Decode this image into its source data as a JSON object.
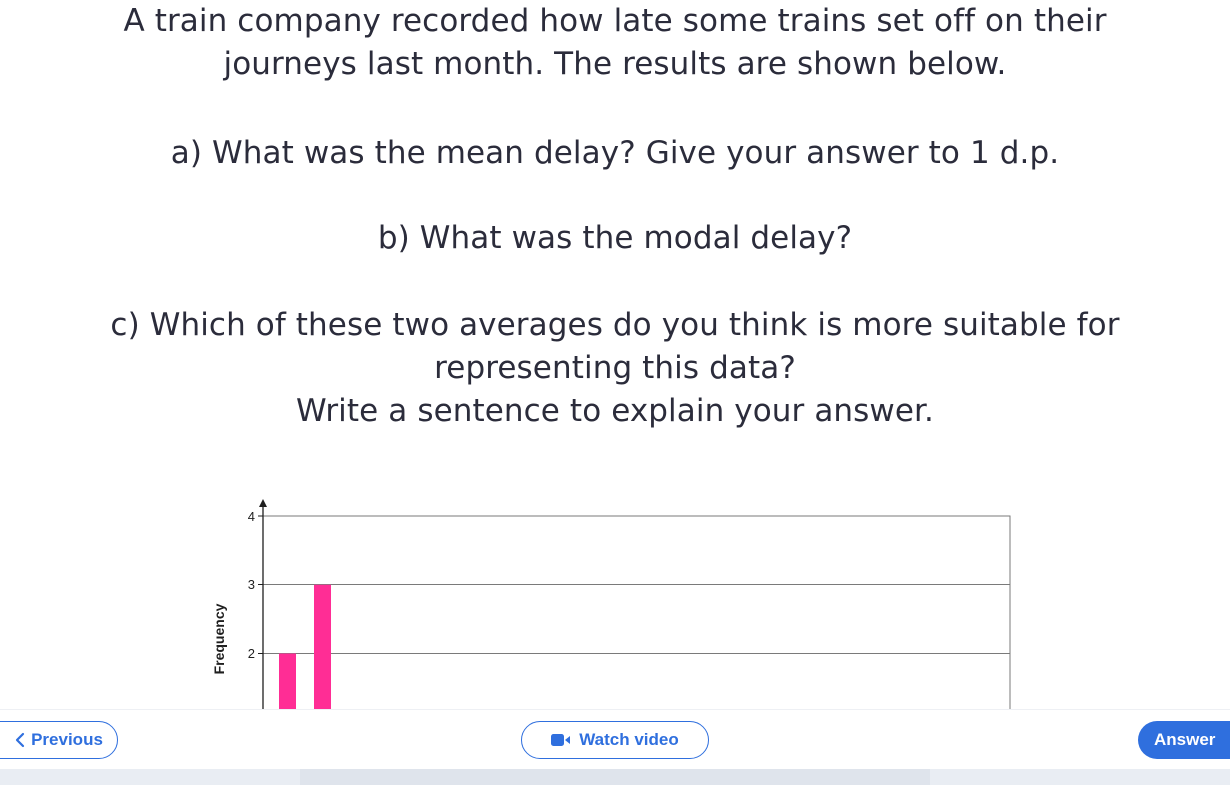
{
  "question": {
    "intro": "A train company recorded how late some trains set off on their journeys last month. The results are shown below.",
    "part_a": "a) What was the mean delay? Give your answer to 1 d.p.",
    "part_b": "b) What was the modal delay?",
    "part_c_line1": "c) Which of these two averages do you think is more suitable for",
    "part_c_line2": "representing this data?",
    "part_c_line3": "Write a sentence to explain your answer."
  },
  "chart_data": {
    "type": "bar",
    "ylabel": "Frequency",
    "y_ticks": [
      "2",
      "3",
      "4"
    ],
    "values": [
      2,
      3
    ],
    "bar_color": "#ff2d95"
  },
  "nav": {
    "previous_label": "Previous",
    "watch_label": "Watch video",
    "answer_label": "Answer",
    "accent_color": "#2f6fde"
  },
  "icons": {
    "previous": "chevron-left-icon",
    "watch": "video-camera-icon"
  }
}
